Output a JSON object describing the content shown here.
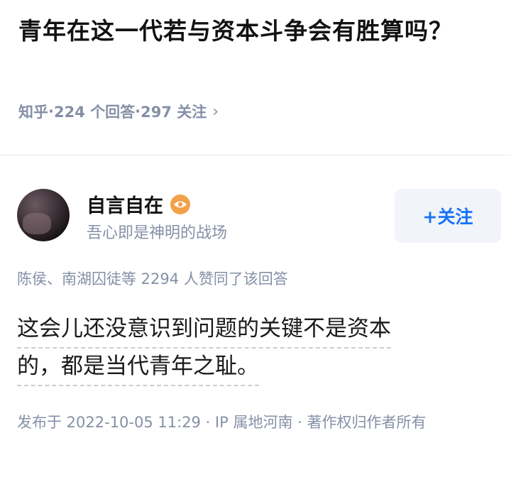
{
  "question": {
    "title": "青年在这一代若与资本斗争会有胜算吗？",
    "source": "知乎",
    "answers": "224 个回答",
    "followers": "297 关注",
    "chevron": "›"
  },
  "author": {
    "name": "自言自在",
    "badge_icon": "eye-icon",
    "bio": "吾心即是神明的战场",
    "follow_label": "+关注"
  },
  "upvotes": "陈侯、南湖囚徒等 2294 人赞同了该回答",
  "answer": {
    "line1": "这会儿还没意识到问题的关键不是资本",
    "line2": "的，都是当代青年之耻。"
  },
  "meta": "发布于 2022-10-05 11:29 · IP 属地河南 · 著作权归作者所有",
  "colors": {
    "accent": "#1772f6",
    "muted": "#8590a6",
    "badge": "#f2a14a"
  }
}
